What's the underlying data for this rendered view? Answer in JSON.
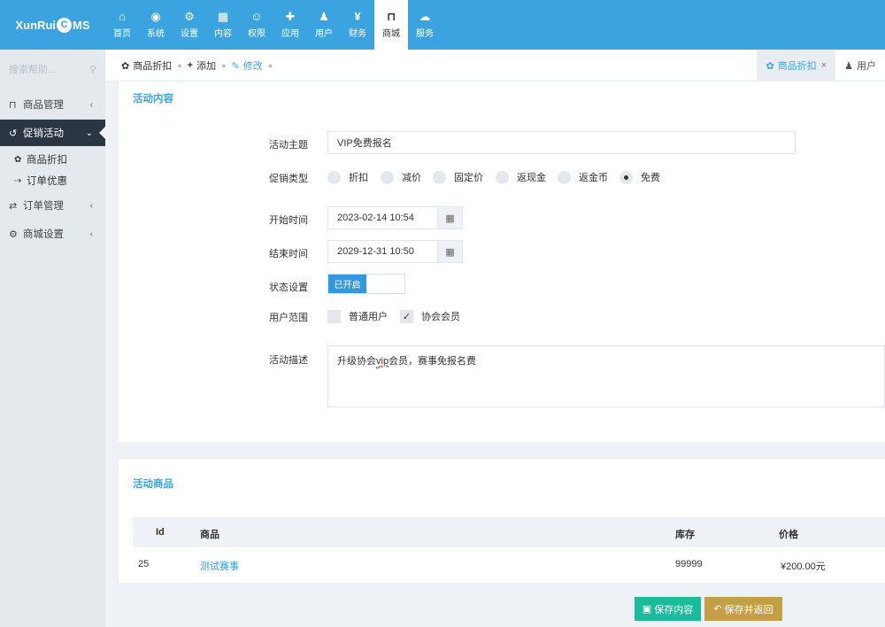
{
  "app": {
    "logo_prefix": "XunRui",
    "logo_o": "C",
    "logo_suffix": "MS"
  },
  "nav": [
    {
      "icon": "home-icon",
      "glyph": "⌂",
      "label": "首页"
    },
    {
      "icon": "globe-icon",
      "glyph": "◉",
      "label": "系统"
    },
    {
      "icon": "cogs-icon",
      "glyph": "⚙",
      "label": "设置"
    },
    {
      "icon": "grid-icon",
      "glyph": "▦",
      "label": "内容"
    },
    {
      "icon": "user-circle-icon",
      "glyph": "☺",
      "label": "权限"
    },
    {
      "icon": "puzzle-icon",
      "glyph": "✚",
      "label": "应用"
    },
    {
      "icon": "user-icon",
      "glyph": "♟",
      "label": "用户"
    },
    {
      "icon": "yen-icon",
      "glyph": "¥",
      "label": "财务"
    },
    {
      "icon": "cart-icon",
      "glyph": "⊓",
      "label": "商城"
    },
    {
      "icon": "cloud-icon",
      "glyph": "☁",
      "label": "服务"
    }
  ],
  "sidebar": {
    "search_placeholder": "搜索帮助...",
    "items": [
      {
        "label": "商品管理",
        "icon": "cart-icon",
        "glyph": "⊓"
      },
      {
        "label": "促销活动",
        "icon": "history-icon",
        "glyph": "↺"
      },
      {
        "label": "订单管理",
        "icon": "handshake-icon",
        "glyph": "⇄"
      },
      {
        "label": "商城设置",
        "icon": "gear-icon",
        "glyph": "⚙"
      }
    ],
    "sub_items": [
      {
        "label": "商品折扣",
        "icon": "gift-icon",
        "glyph": "✿"
      },
      {
        "label": "订单优惠",
        "icon": "cart-arrow-icon",
        "glyph": "⇢"
      }
    ]
  },
  "breadcrumb": {
    "item1": "商品折扣",
    "item2": "添加",
    "item3": "修改"
  },
  "page_tabs": [
    {
      "label": "商品折扣"
    },
    {
      "label": "用户"
    }
  ],
  "form": {
    "section_title": "活动内容",
    "subject_label": "活动主题",
    "subject_value": "VIP免费报名",
    "type_label": "促销类型",
    "types": [
      "折扣",
      "减价",
      "固定价",
      "返现金",
      "返金币",
      "免费"
    ],
    "selected_type": "免费",
    "start_label": "开始时间",
    "start_value": "2023-02-14 10:54",
    "end_label": "结束时间",
    "end_value": "2029-12-31 10:50",
    "status_label": "状态设置",
    "status_value": "已开启",
    "scope_label": "用户范围",
    "scopes": [
      {
        "label": "普通用户",
        "checked": false
      },
      {
        "label": "协会会员",
        "checked": true
      }
    ],
    "desc_label": "活动描述",
    "desc_before": "升级协会",
    "desc_vip": "vip",
    "desc_after": "会员，赛事免报名费"
  },
  "goods": {
    "section_title": "活动商品",
    "columns": [
      "Id",
      "商品",
      "库存",
      "价格"
    ],
    "rows": [
      {
        "id": "25",
        "name": "测试赛事",
        "stock": "99999",
        "price": "¥200.00元"
      }
    ]
  },
  "footer": {
    "save_label": "保存内容",
    "save_back_label": "保存并返回"
  },
  "colors": {
    "topbar": "#3ba4e0",
    "sidebar_active": "#2b3643",
    "link": "#3598dc",
    "save_button": "#1bbc9b",
    "save_back_button": "#c49f47"
  }
}
